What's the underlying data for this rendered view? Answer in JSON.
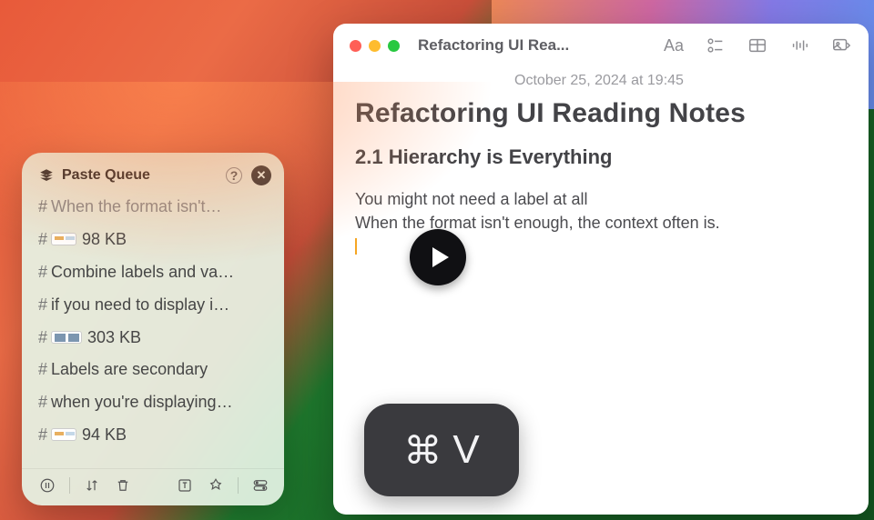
{
  "pasteQueue": {
    "title": "Paste Queue",
    "items": [
      {
        "text": "When the format isn't…"
      },
      {
        "thumb": "w1",
        "text": "98 KB"
      },
      {
        "text": "Combine labels and va…"
      },
      {
        "text": "if you need to display i…"
      },
      {
        "thumb": "w2",
        "text": "303 KB"
      },
      {
        "text": "Labels are secondary"
      },
      {
        "text": "when you're displaying…"
      },
      {
        "thumb": "w1",
        "text": "94 KB"
      }
    ]
  },
  "notes": {
    "windowTitle": "Refactoring UI Rea...",
    "date": "October 25, 2024 at 19:45",
    "h1": "Refactoring UI Reading Notes",
    "h2": "2.1 Hierarchy is Everything",
    "line1": "You might not need a label at all",
    "line2": "When the format isn't enough, the context often is."
  },
  "shortcut": {
    "symbol": "⌘",
    "key": "V"
  }
}
